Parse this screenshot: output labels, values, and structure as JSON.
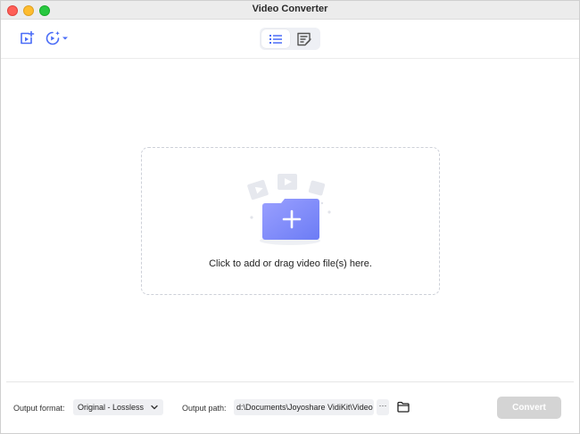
{
  "window": {
    "title": "Video Converter"
  },
  "toolbar": {
    "add_files_icon": "add-video-file-icon",
    "tools_icon": "magic-tools-icon",
    "view_list_icon": "list-view-icon",
    "view_task_icon": "task-list-icon"
  },
  "main": {
    "drop_text": "Click to add or drag video file(s) here."
  },
  "footer": {
    "output_format_label": "Output format:",
    "output_format_value": "Original - Lossless",
    "output_path_label": "Output path:",
    "output_path_value": "d:\\Documents\\Joyoshare VidiKit\\Video",
    "more_label": "···",
    "convert_label": "Convert"
  },
  "colors": {
    "accent": "#4a6cf7",
    "folder_gradient_start": "#9aa0ff",
    "folder_gradient_end": "#6c7cf5",
    "convert_disabled": "#d4d4d4"
  }
}
